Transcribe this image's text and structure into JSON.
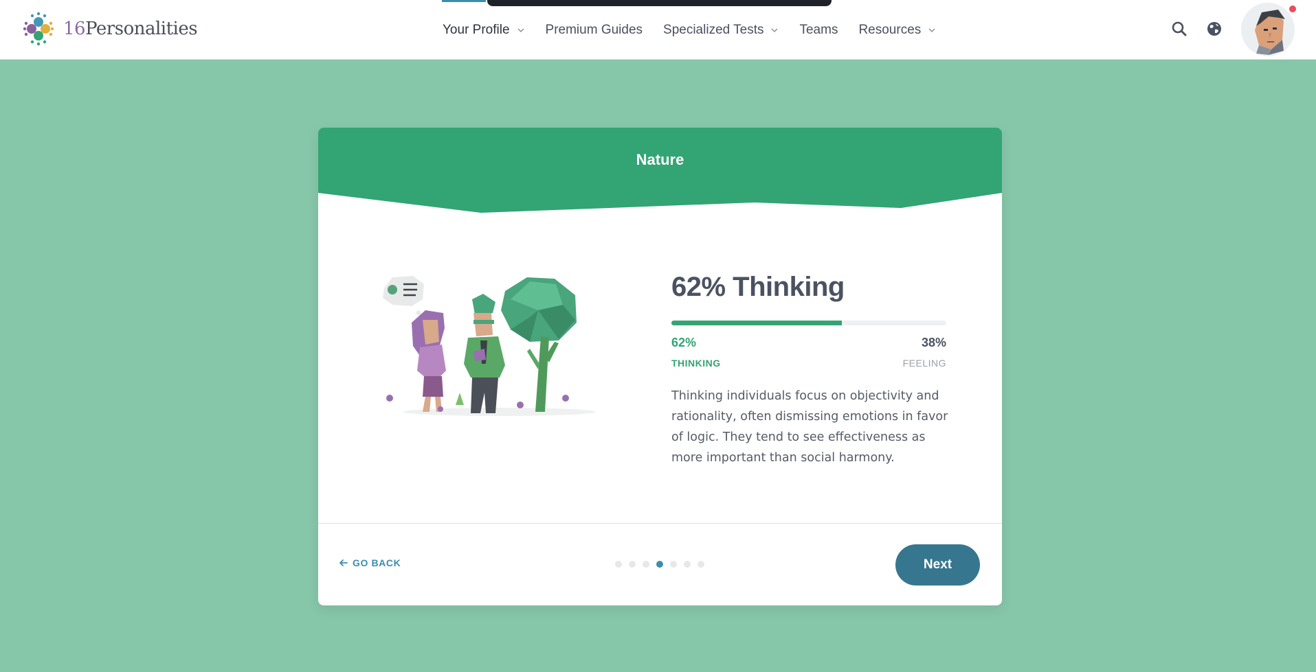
{
  "header": {
    "logo_text_number": "16",
    "logo_text_word": "Personalities",
    "nav": [
      {
        "label": "Your Profile",
        "has_dropdown": true,
        "active": true
      },
      {
        "label": "Premium Guides",
        "has_dropdown": false
      },
      {
        "label": "Specialized Tests",
        "has_dropdown": true
      },
      {
        "label": "Teams",
        "has_dropdown": false
      },
      {
        "label": "Resources",
        "has_dropdown": true
      }
    ],
    "icons": [
      "search-icon",
      "globe-icon"
    ],
    "notification": true
  },
  "card": {
    "title": "Nature",
    "result_title": "62% Thinking",
    "progress_fraction": 0.62,
    "left_pct": "62%",
    "left_label": "THINKING",
    "right_pct": "38%",
    "right_label": "FEELING",
    "description": "Thinking individuals focus on objectivity and rationality, often dismissing emotions in favor of logic. They tend to see effectiveness as more important than social harmony.",
    "go_back": "GO BACK",
    "next": "Next",
    "pager": {
      "total": 7,
      "current": 4
    }
  },
  "colors": {
    "background": "#86c6a9",
    "header_green": "#33a474",
    "accent_blue": "#3a8eae",
    "button": "#36778f"
  }
}
